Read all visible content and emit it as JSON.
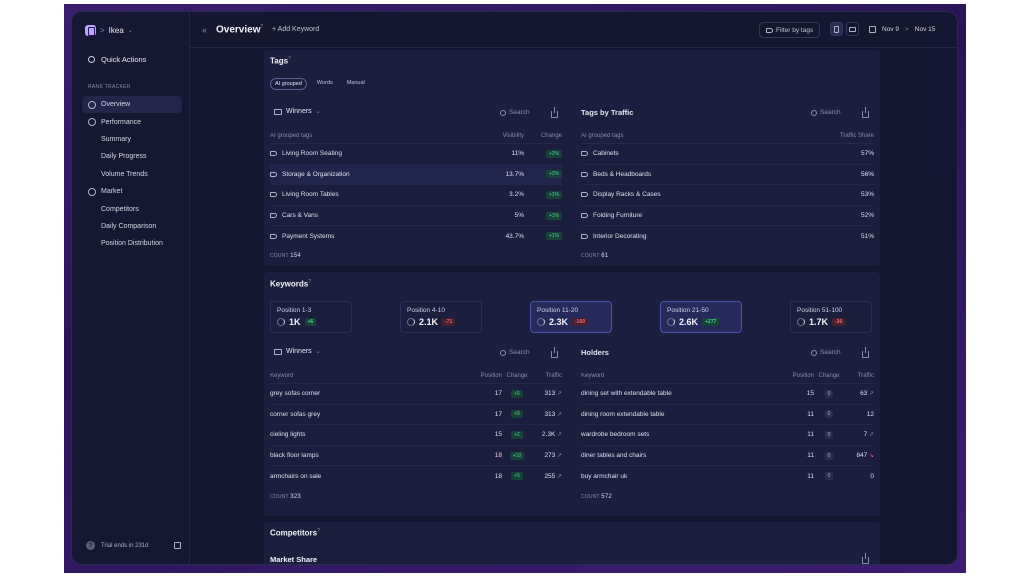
{
  "workspace": {
    "name": "Ikea",
    "separator": ">"
  },
  "sidebar": {
    "quick_actions": "Quick Actions",
    "section_label": "RANK TRACKER",
    "items": [
      {
        "label": "Overview",
        "icon": "overview-icon",
        "active": true
      },
      {
        "label": "Performance",
        "icon": "performance-icon"
      },
      {
        "label": "Summary",
        "sub": true
      },
      {
        "label": "Daily Progress",
        "sub": true
      },
      {
        "label": "Volume Trends",
        "sub": true
      },
      {
        "label": "Market",
        "icon": "market-icon"
      },
      {
        "label": "Competitors",
        "sub": true
      },
      {
        "label": "Daily Comparison",
        "sub": true
      },
      {
        "label": "Position Distribution",
        "sub": true
      }
    ],
    "trial": "Trial ends in 231d"
  },
  "topbar": {
    "collapse": "«",
    "title": "Overview",
    "title_help": "?",
    "add_keyword": "+ Add Keyword",
    "filter": "Filter by tags",
    "date_from": "Nov 9",
    "date_arrow": ">",
    "date_to": "Nov 15"
  },
  "tags": {
    "title": "Tags",
    "help": "?",
    "pills": [
      "AI grouped",
      "Words",
      "Manual"
    ],
    "winners": {
      "dropdown": "Winners",
      "search": "Search",
      "col_name": "AI grouped tags",
      "col_visibility": "Visibility",
      "col_change": "Change",
      "rows": [
        {
          "name": "Living Room Seating",
          "visibility": "11%",
          "change": "+2%"
        },
        {
          "name": "Storage & Organization",
          "visibility": "13.7%",
          "change": "+2%"
        },
        {
          "name": "Living Room Tables",
          "visibility": "3.2%",
          "change": "+1%"
        },
        {
          "name": "Cars & Vans",
          "visibility": "5%",
          "change": "+1%"
        },
        {
          "name": "Payment Systems",
          "visibility": "43.7%",
          "change": "+1%"
        }
      ],
      "count_label": "COUNT",
      "count": "154"
    },
    "by_traffic": {
      "title": "Tags by Traffic",
      "search": "Search",
      "col_name": "AI grouped tags",
      "col_share": "Traffic Share",
      "rows": [
        {
          "name": "Cabinets",
          "share": "57%"
        },
        {
          "name": "Beds & Headboards",
          "share": "56%"
        },
        {
          "name": "Display Racks & Cases",
          "share": "53%"
        },
        {
          "name": "Folding Furniture",
          "share": "52%"
        },
        {
          "name": "Interior Decorating",
          "share": "51%"
        }
      ],
      "count_label": "COUNT",
      "count": "61"
    }
  },
  "keywords": {
    "title": "Keywords",
    "help": "?",
    "positions": [
      {
        "label": "Position 1-3",
        "value": "1K",
        "delta": "+6",
        "dir": "up"
      },
      {
        "label": "Position 4-10",
        "value": "2.1K",
        "delta": "-71",
        "dir": "down"
      },
      {
        "label": "Position 11-20",
        "value": "2.3K",
        "delta": "-169",
        "dir": "down"
      },
      {
        "label": "Position 21-50",
        "value": "2.6K",
        "delta": "+277",
        "dir": "up"
      },
      {
        "label": "Position 51-100",
        "value": "1.7K",
        "delta": "-36",
        "dir": "down"
      }
    ],
    "winners": {
      "dropdown": "Winners",
      "search": "Search",
      "col_keyword": "Keyword",
      "col_position": "Position",
      "col_change": "Change",
      "col_traffic": "Traffic",
      "rows": [
        {
          "keyword": "grey sofas corner",
          "position": "17",
          "change": "+5",
          "traffic": "313",
          "trend": "up"
        },
        {
          "keyword": "corner sofas grey",
          "position": "17",
          "change": "+5",
          "traffic": "313",
          "trend": "up"
        },
        {
          "keyword": "cieling lights",
          "position": "15",
          "change": "+2",
          "traffic": "2.3K",
          "trend": "up"
        },
        {
          "keyword": "black floor lamps",
          "position": "18",
          "change": "+10",
          "traffic": "273",
          "trend": "up"
        },
        {
          "keyword": "armchairs on sale",
          "position": "18",
          "change": "+5",
          "traffic": "255",
          "trend": "up"
        }
      ],
      "count_label": "COUNT",
      "count": "323"
    },
    "holders": {
      "title": "Holders",
      "search": "Search",
      "col_keyword": "Keyword",
      "col_position": "Position",
      "col_change": "Change",
      "col_traffic": "Traffic",
      "rows": [
        {
          "keyword": "dining set with extendable table",
          "position": "15",
          "change": "0",
          "traffic": "63",
          "trend": "up"
        },
        {
          "keyword": "dining room extendable table",
          "position": "11",
          "change": "0",
          "traffic": "12",
          "trend": ""
        },
        {
          "keyword": "wardrobe bedroom sets",
          "position": "11",
          "change": "0",
          "traffic": "7",
          "trend": "up"
        },
        {
          "keyword": "diner tables and chairs",
          "position": "11",
          "change": "0",
          "traffic": "847",
          "trend": "down"
        },
        {
          "keyword": "buy armchair uk",
          "position": "11",
          "change": "0",
          "traffic": "0",
          "trend": ""
        }
      ],
      "count_label": "COUNT",
      "count": "572"
    }
  },
  "competitors": {
    "title": "Competitors",
    "help": "?",
    "market_share": "Market Share"
  },
  "colors": {
    "background": "#151730",
    "card": "#1b1e3c",
    "positive": "#4fd39a",
    "negative": "#f06b7d",
    "frame": "#3a1e6e"
  }
}
